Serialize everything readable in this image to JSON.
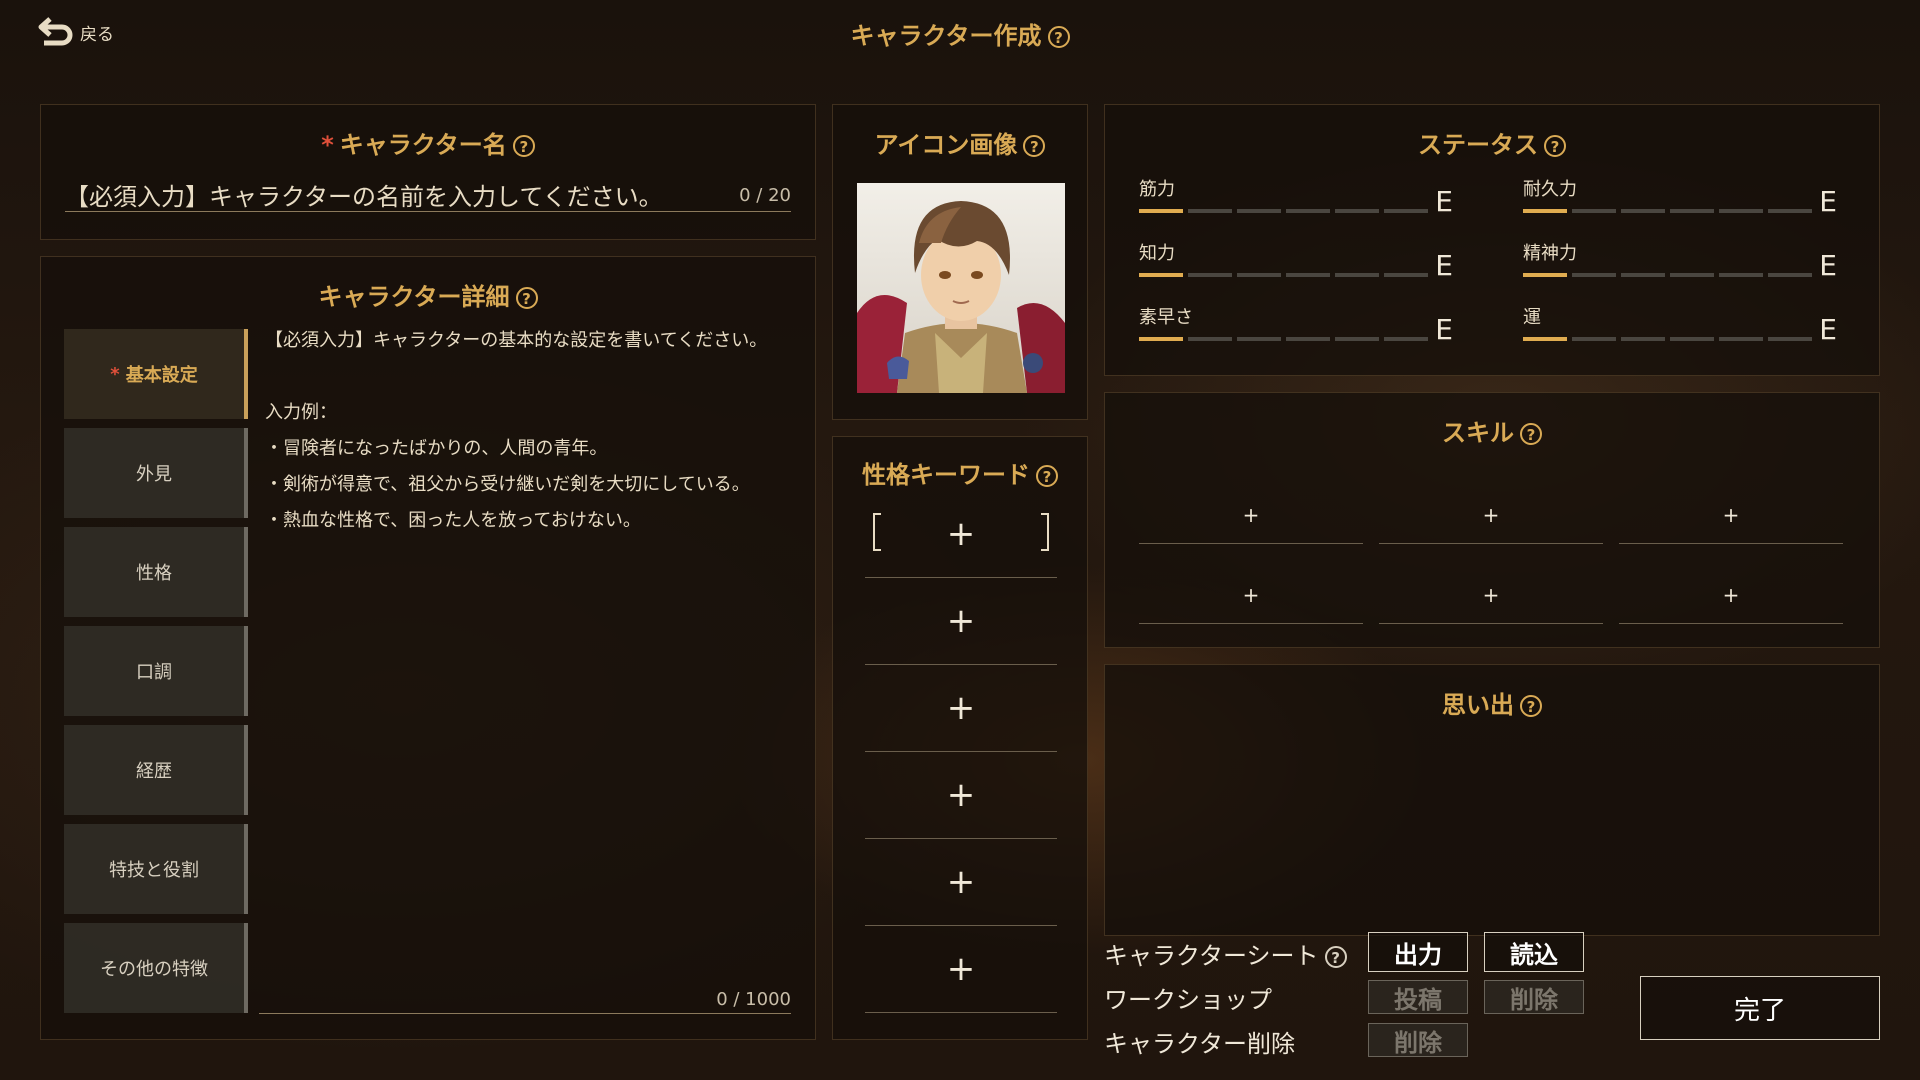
{
  "header": {
    "back_label": "戻る",
    "title": "キャラクター作成"
  },
  "name": {
    "title": "キャラクター名",
    "required_mark": "*",
    "placeholder": "【必須入力】キャラクターの名前を入力してください。",
    "count": "0 / 20"
  },
  "details": {
    "title": "キャラクター詳細",
    "tabs": [
      {
        "label": "基本設定",
        "required_mark": "*"
      },
      {
        "label": "外見"
      },
      {
        "label": "性格"
      },
      {
        "label": "口調"
      },
      {
        "label": "経歴"
      },
      {
        "label": "特技と役割"
      },
      {
        "label": "その他の特徴"
      }
    ],
    "text_lines": [
      "【必須入力】キャラクターの基本的な設定を書いてください。",
      "",
      "入力例：",
      "・冒険者になったばかりの、人間の青年。",
      "・剣術が得意で、祖父から受け継いだ剣を大切にしている。",
      "・熱血な性格で、困った人を放っておけない。"
    ],
    "count": "0 / 1000"
  },
  "icon": {
    "title": "アイコン画像"
  },
  "keywords": {
    "title": "性格キーワード",
    "slots": [
      "+",
      "+",
      "+",
      "+",
      "+",
      "+"
    ]
  },
  "status": {
    "title": "ステータス",
    "stats": [
      {
        "label": "筋力",
        "rank": "E",
        "level": 1,
        "max": 6
      },
      {
        "label": "耐久力",
        "rank": "E",
        "level": 1,
        "max": 6
      },
      {
        "label": "知力",
        "rank": "E",
        "level": 1,
        "max": 6
      },
      {
        "label": "精神力",
        "rank": "E",
        "level": 1,
        "max": 6
      },
      {
        "label": "素早さ",
        "rank": "E",
        "level": 1,
        "max": 6
      },
      {
        "label": "運",
        "rank": "E",
        "level": 1,
        "max": 6
      }
    ]
  },
  "skills": {
    "title": "スキル",
    "slots": [
      "+",
      "+",
      "+",
      "+",
      "+",
      "+"
    ]
  },
  "memories": {
    "title": "思い出"
  },
  "bottom": {
    "sheet_label": "キャラクターシート",
    "export_label": "出力",
    "import_label": "読込",
    "workshop_label": "ワークショップ",
    "post_label": "投稿",
    "ws_delete_label": "削除",
    "char_delete_label": "キャラクター削除",
    "delete_label": "削除",
    "done_label": "完了"
  },
  "colors": {
    "accent": "#d9aa55",
    "required": "#e0503a",
    "bar_on": "#e0ac50",
    "bar_off": "#4a4640"
  }
}
